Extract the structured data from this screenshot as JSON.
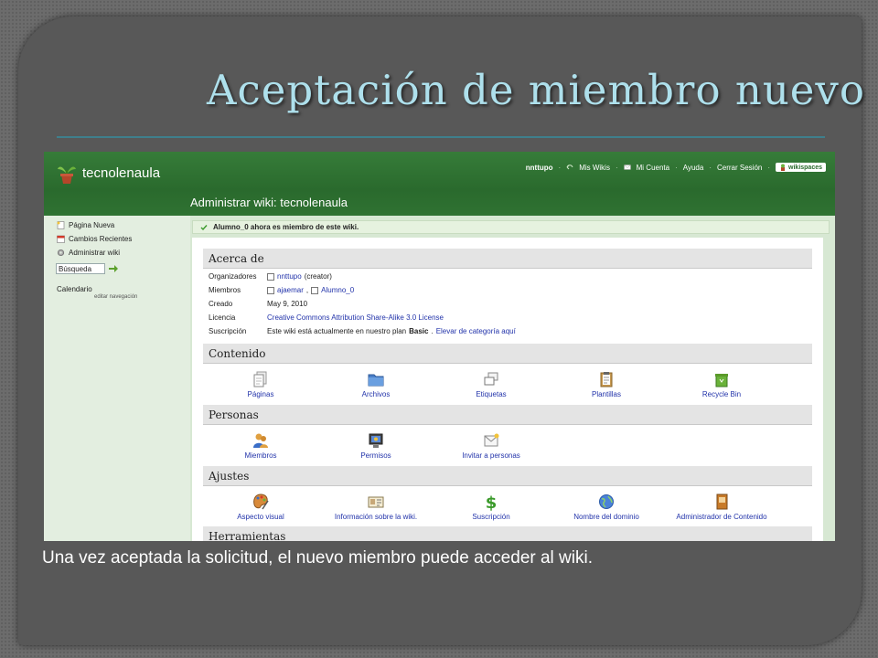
{
  "slide": {
    "title": "Aceptación de miembro nuevo",
    "caption": "Una vez aceptada la solicitud, el nuevo miembro puede acceder al wiki."
  },
  "wiki": {
    "site_name": "tecnolenaula",
    "admin_title": "Administrar wiki: tecnolenaula",
    "top_links": {
      "user": "nnttupo",
      "sep": "·",
      "mis_wikis": "Mis Wikis",
      "mi_cuenta": "Mi Cuenta",
      "ayuda": "Ayuda",
      "cerrar_sesion": "Cerrar Sesión",
      "badge": "wikispaces"
    },
    "sidebar": {
      "pagina_nueva": "Página Nueva",
      "cambios_recientes": "Cambios Recientes",
      "administrar_wiki": "Administrar wiki",
      "search_value": "Búsqueda",
      "calendario": "Calendario",
      "editar_navegacion": "editar navegación"
    },
    "notice": "Alumno_0 ahora es miembro de este wiki.",
    "acerca": {
      "heading": "Acerca de",
      "organizadores_k": "Organizadores",
      "organizadores_v": "nnttupo",
      "organizadores_note": "(creator)",
      "miembros_k": "Miembros",
      "miembro1": "ajaemar",
      "miembro_sep": ",",
      "miembro2": "Alumno_0",
      "creado_k": "Creado",
      "creado_v": "May 9, 2010",
      "licencia_k": "Licencia",
      "licencia_v": "Creative Commons Attribution Share-Alike 3.0 License",
      "suscripcion_k": "Suscripción",
      "suscripcion_v1": "Este wiki está actualmente en nuestro plan",
      "suscripcion_plan": "Basic",
      "suscripcion_sep": ".",
      "suscripcion_link": "Elevar de categoría aquí"
    },
    "contenido": {
      "heading": "Contenido",
      "items": [
        "Páginas",
        "Archivos",
        "Etiquetas",
        "Plantillas",
        "Recycle Bin"
      ]
    },
    "personas": {
      "heading": "Personas",
      "items": [
        "Miembros",
        "Permisos",
        "Invitar a personas"
      ]
    },
    "ajustes": {
      "heading": "Ajustes",
      "items": [
        "Aspecto visual",
        "Información sobre la wiki.",
        "Suscripción",
        "Nombre del dominio",
        "Administrador de Contenido"
      ]
    },
    "herramientas": {
      "heading": "Herramientas"
    }
  },
  "colors": {
    "header_green": "#2c6e30",
    "title_cyan": "#aee0ec",
    "link_blue": "#2233aa",
    "slide_bg": "#585858"
  }
}
